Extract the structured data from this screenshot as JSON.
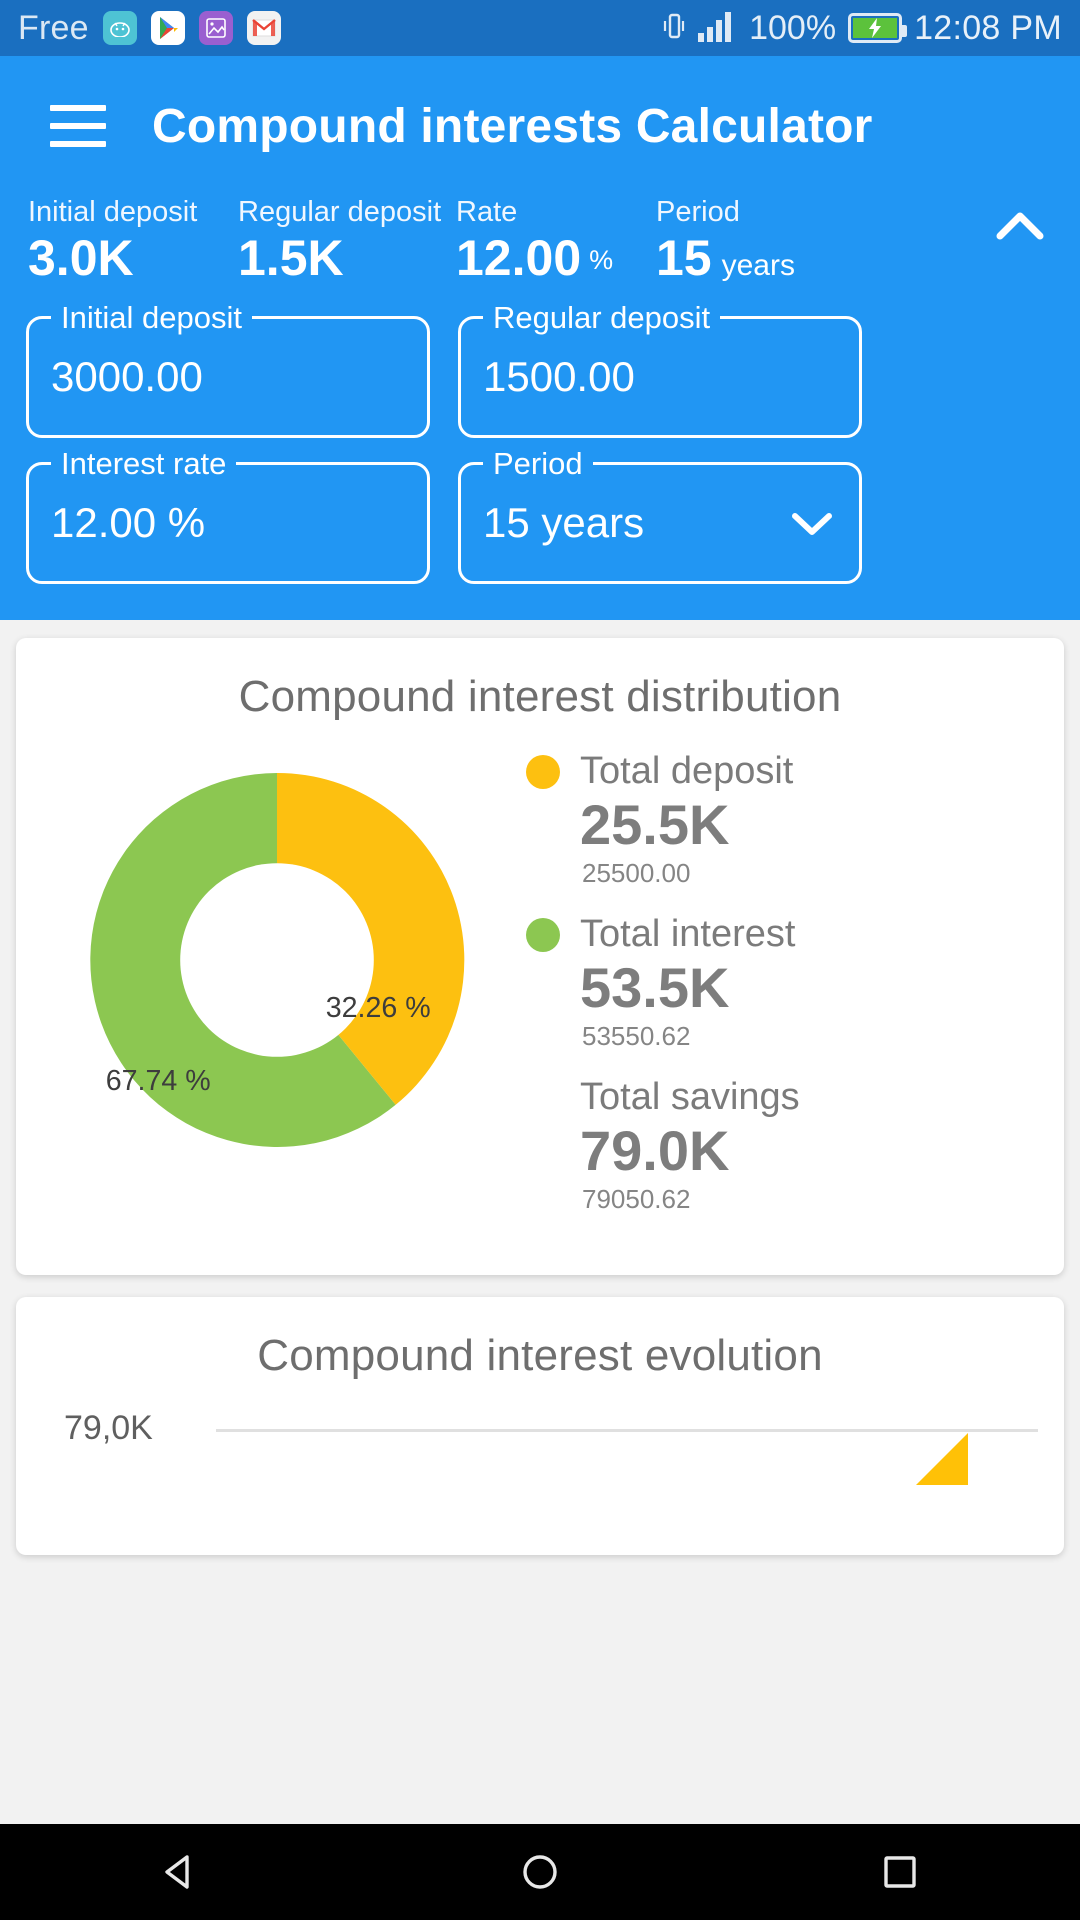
{
  "status_bar": {
    "carrier": "Free",
    "icons": [
      "android-icon",
      "play-store-icon",
      "photos-icon",
      "gmail-icon"
    ],
    "vibrate_icon": "vibrate-icon",
    "signal_icon": "signal-bars-icon",
    "battery_percent": "100%",
    "battery_icon": "battery-charging-icon",
    "time": "12:08 PM"
  },
  "appbar": {
    "menu_icon": "hamburger-menu-icon",
    "title": "Compound interests Calculator",
    "collapse_icon": "chevron-up-icon"
  },
  "summary": [
    {
      "label": "Initial deposit",
      "value": "3.0K",
      "unit": ""
    },
    {
      "label": "Regular deposit",
      "value": "1.5K",
      "unit": ""
    },
    {
      "label": "Rate",
      "value": "12.00",
      "unit": "%"
    },
    {
      "label": "Period",
      "value": "15",
      "unit": "years"
    }
  ],
  "fields": [
    {
      "label": "Initial deposit",
      "value": "3000.00",
      "caret": false
    },
    {
      "label": "Regular deposit",
      "value": "1500.00",
      "caret": false
    },
    {
      "label": "Interest rate",
      "value": "12.00 %",
      "caret": false
    },
    {
      "label": "Period",
      "value": "15 years",
      "caret": true
    }
  ],
  "distribution_card": {
    "title": "Compound interest distribution",
    "legend": [
      {
        "name": "Total deposit",
        "big": "25.5K",
        "small": "25500.00",
        "color": "#fdc010",
        "has_dot": true
      },
      {
        "name": "Total interest",
        "big": "53.5K",
        "small": "53550.62",
        "color": "#8cc council",
        "has_dot": true
      },
      {
        "name": "Total savings",
        "big": "79.0K",
        "small": "79050.62",
        "color": "",
        "has_dot": false
      }
    ]
  },
  "evolution_card": {
    "title": "Compound interest evolution",
    "y_axis_top_label": "79,0K"
  },
  "navbar": {
    "back_icon": "back-triangle-icon",
    "home_icon": "home-circle-icon",
    "recents_icon": "recents-square-icon"
  },
  "colors": {
    "primary": "#2196f3",
    "status_bar": "#1a6fc0",
    "deposit": "#fdc010",
    "interest": "#8cc751",
    "page_bg": "#f2f2f2"
  },
  "chart_data": {
    "type": "pie",
    "title": "Compound interest distribution",
    "labels": [
      "Total deposit",
      "Total interest"
    ],
    "values": [
      25500.0,
      53550.62
    ],
    "percentages": [
      32.26,
      67.74
    ],
    "percent_labels": [
      "32.26 %",
      "67.74 %"
    ],
    "colors": [
      "#fdc010",
      "#8cc751"
    ],
    "total": 79050.62,
    "total_label": "Total savings",
    "donut": true,
    "inner_radius_ratio": 0.52,
    "start_angle_deg": -90,
    "legend_position": "right",
    "grid": false
  }
}
